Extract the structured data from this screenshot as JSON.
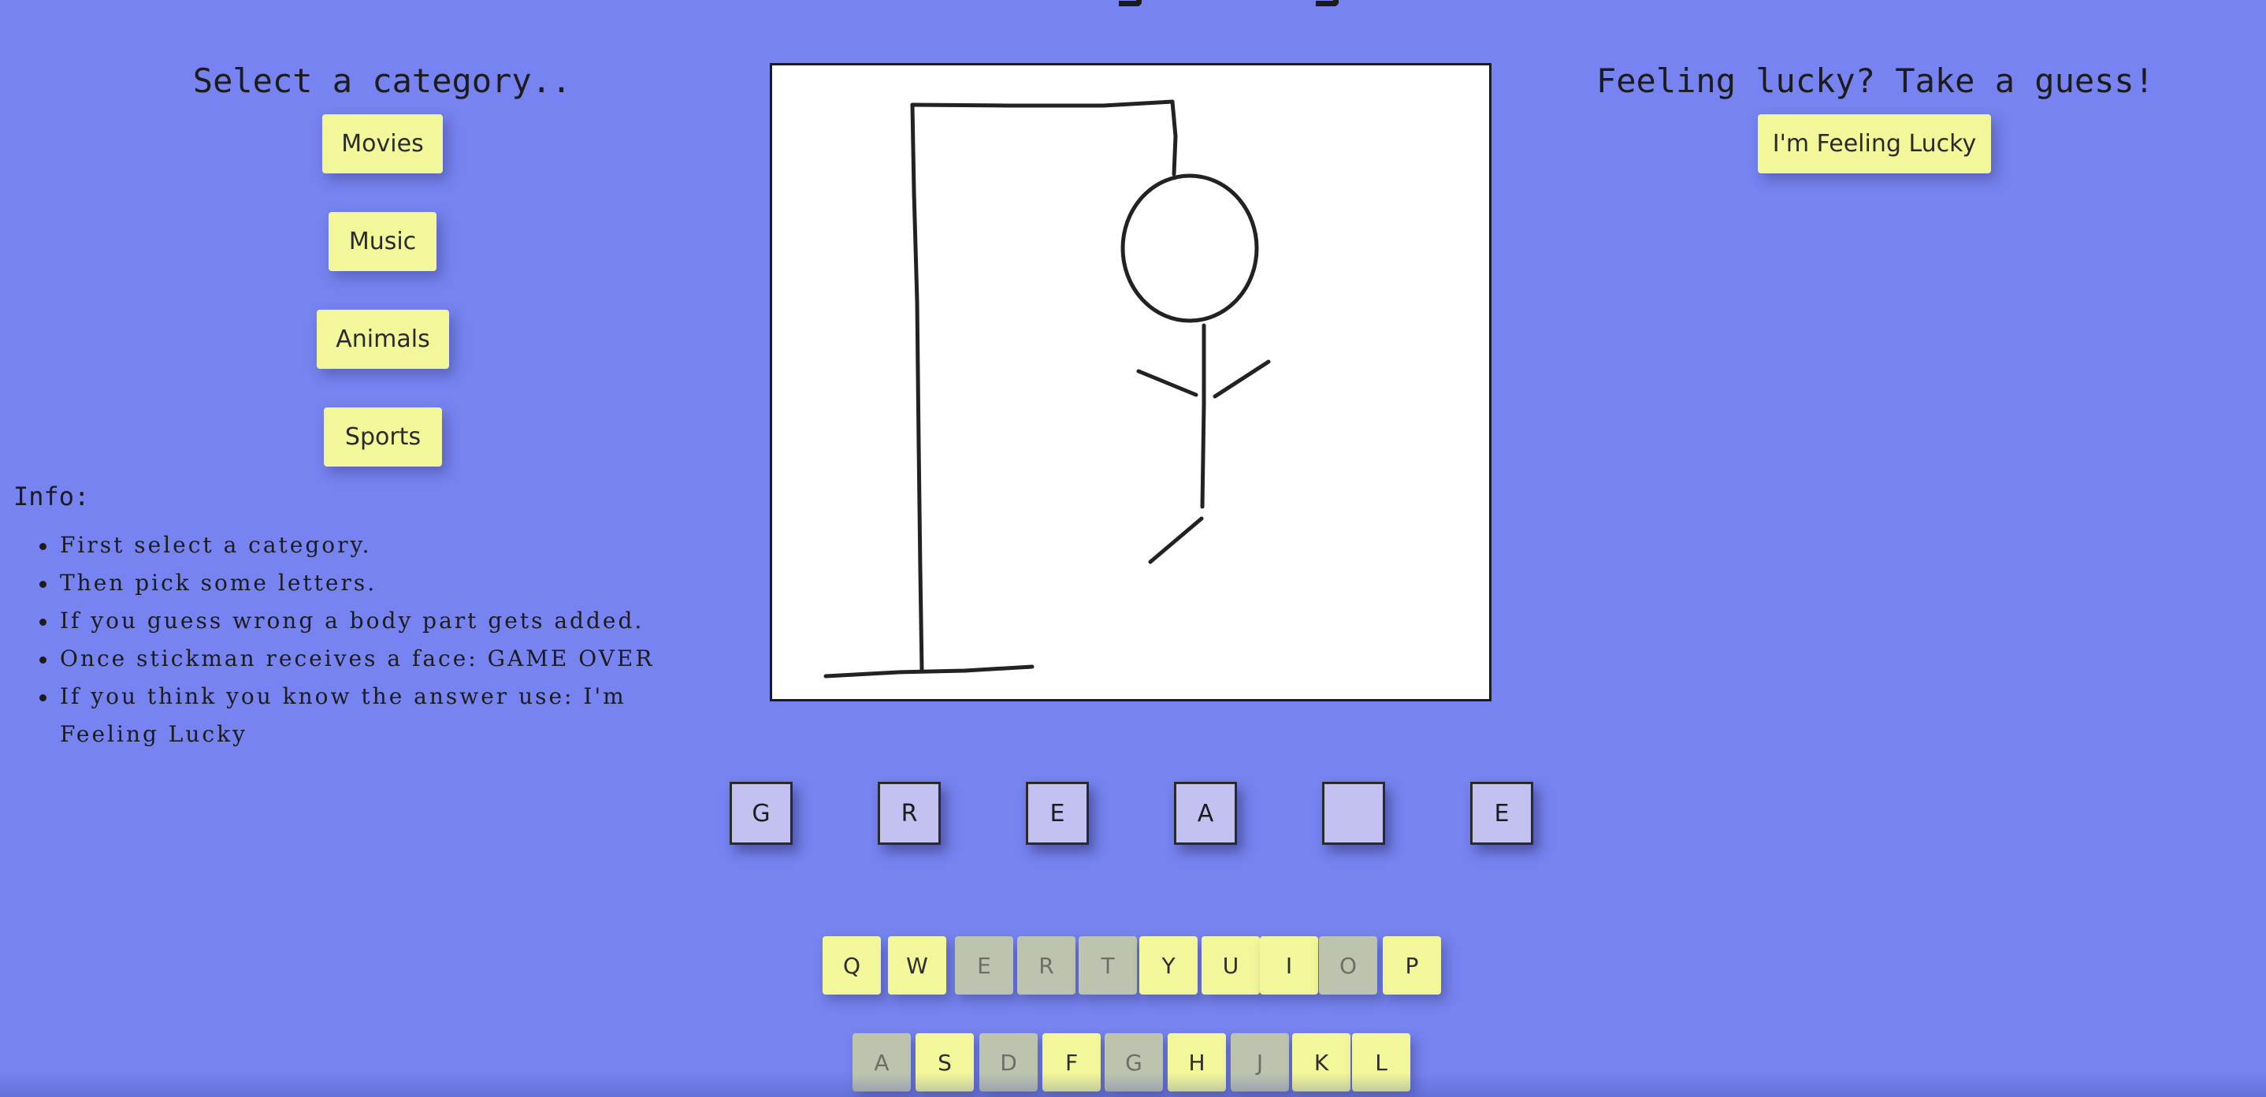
{
  "categories": {
    "heading": "Select a category..",
    "buttons": [
      "Movies",
      "Music",
      "Animals",
      "Sports"
    ]
  },
  "info": {
    "heading": "Info:",
    "items": [
      "First select a category.",
      "Then pick some letters.",
      "If you guess wrong a body part gets added.",
      "Once stickman receives a face: GAME OVER",
      "If you think you know the answer use: I'm Feeling Lucky"
    ]
  },
  "lucky": {
    "heading": "Feeling lucky? Take a guess!",
    "button": "I'm Feeling Lucky"
  },
  "word": {
    "slots": [
      "G",
      "R",
      "E",
      "A",
      "",
      "E"
    ]
  },
  "keyboard": {
    "row1": [
      {
        "letter": "Q",
        "state": "available"
      },
      {
        "letter": "W",
        "state": "available"
      },
      {
        "letter": "E",
        "state": "used"
      },
      {
        "letter": "R",
        "state": "used"
      },
      {
        "letter": "T",
        "state": "used"
      },
      {
        "letter": "Y",
        "state": "available"
      },
      {
        "letter": "U",
        "state": "available"
      },
      {
        "letter": "I",
        "state": "available"
      },
      {
        "letter": "O",
        "state": "used"
      },
      {
        "letter": "P",
        "state": "available"
      }
    ],
    "row2": [
      {
        "letter": "A",
        "state": "used"
      },
      {
        "letter": "S",
        "state": "available"
      },
      {
        "letter": "D",
        "state": "used"
      },
      {
        "letter": "F",
        "state": "available"
      },
      {
        "letter": "G",
        "state": "used"
      },
      {
        "letter": "H",
        "state": "available"
      },
      {
        "letter": "J",
        "state": "used"
      },
      {
        "letter": "K",
        "state": "available"
      },
      {
        "letter": "L",
        "state": "available"
      }
    ]
  },
  "colors": {
    "background": "#7683f0",
    "button": "#f2f79a",
    "used_key": "#bcc4b0",
    "slot": "#c3c0f2"
  }
}
